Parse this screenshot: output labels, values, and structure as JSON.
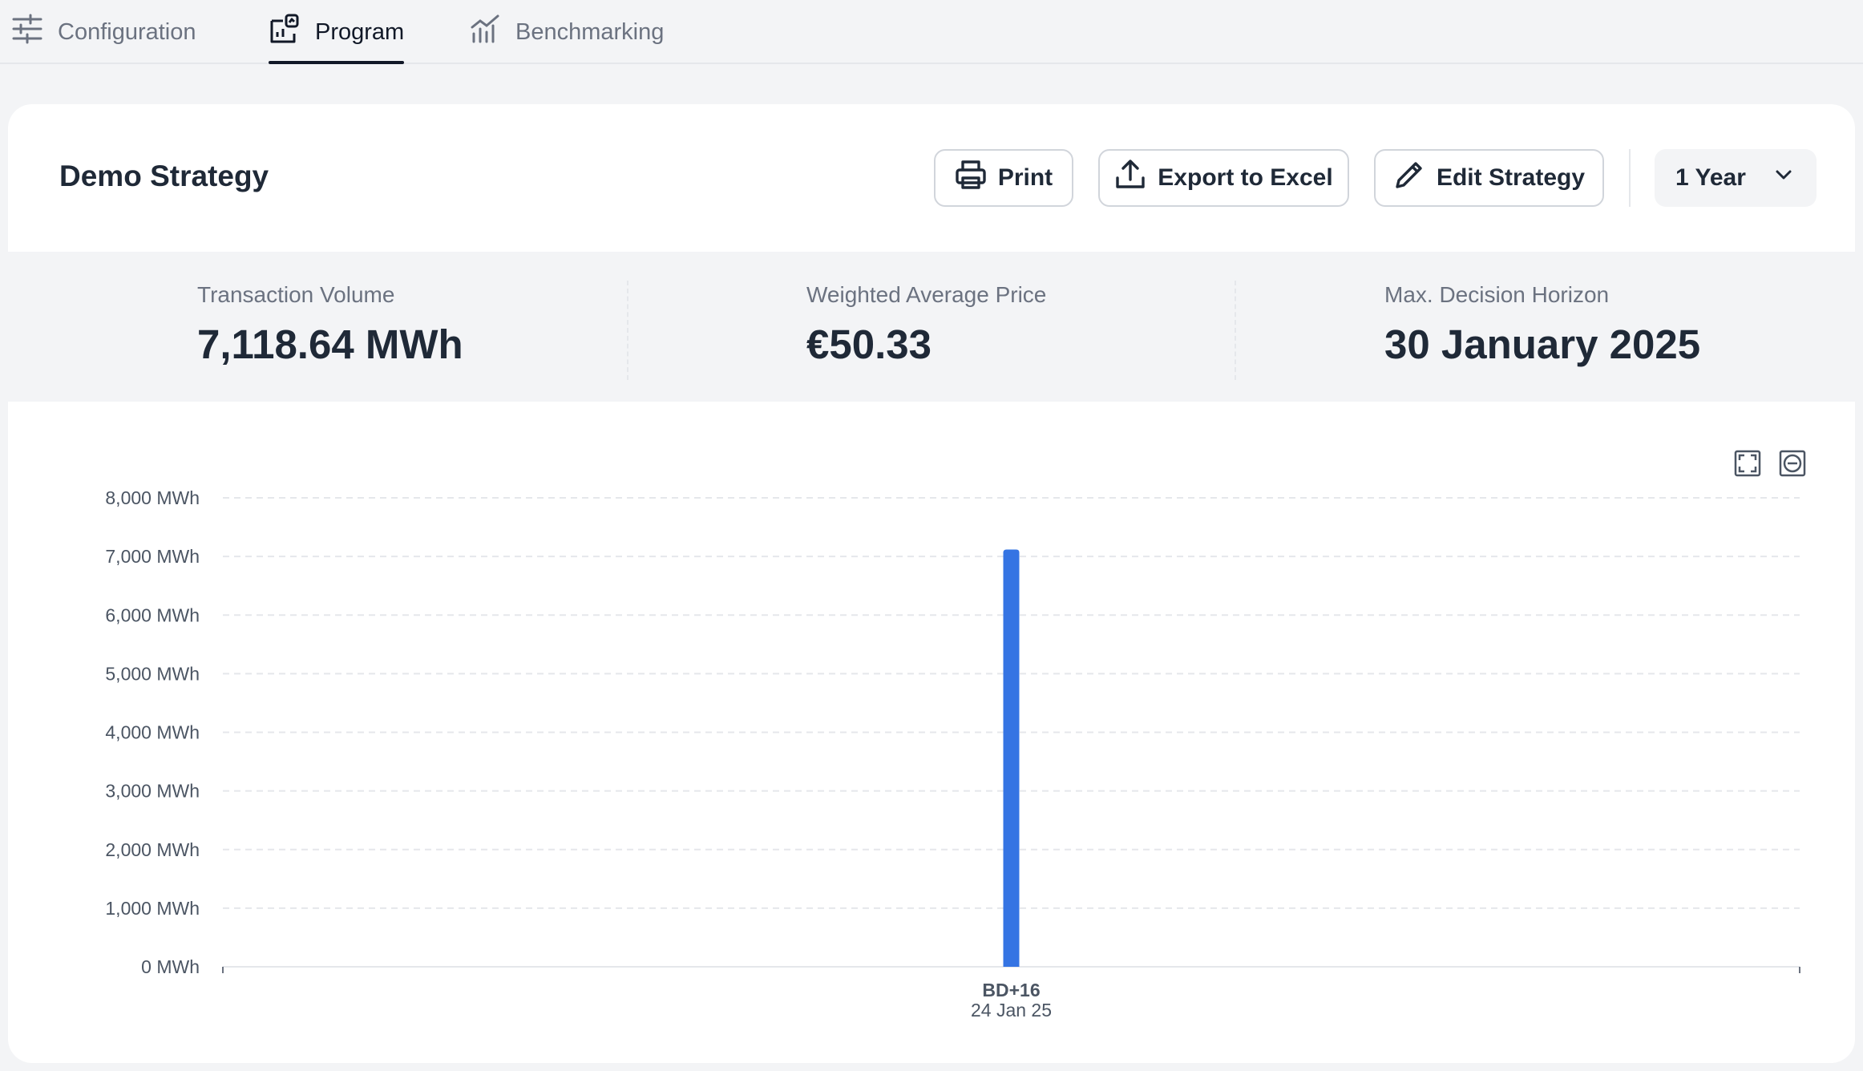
{
  "tabs": [
    {
      "label": "Configuration",
      "icon": "sliders-icon",
      "active": false
    },
    {
      "label": "Program",
      "icon": "program-icon",
      "active": true
    },
    {
      "label": "Benchmarking",
      "icon": "chart-icon",
      "active": false
    }
  ],
  "header": {
    "title": "Demo Strategy",
    "print_label": "Print",
    "export_label": "Export to Excel",
    "edit_label": "Edit Strategy",
    "period_selected": "1 Year"
  },
  "stats": [
    {
      "label": "Transaction Volume",
      "value": "7,118.64 MWh"
    },
    {
      "label": "Weighted Average Price",
      "value": "€50.33"
    },
    {
      "label": "Max. Decision Horizon",
      "value": "30 January 2025"
    }
  ],
  "colors": {
    "accent": "#3574e3",
    "text": "#1f2937",
    "muted": "#6b7280"
  },
  "chart_data": {
    "type": "bar",
    "categories": [
      "BD+16"
    ],
    "category_sublabels": [
      "24 Jan 25"
    ],
    "values": [
      7118.64
    ],
    "ylim": [
      0,
      8000
    ],
    "yticks": [
      0,
      1000,
      2000,
      3000,
      4000,
      5000,
      6000,
      7000,
      8000
    ],
    "ytick_labels": [
      "0 MWh",
      "1,000 MWh",
      "2,000 MWh",
      "3,000 MWh",
      "4,000 MWh",
      "5,000 MWh",
      "6,000 MWh",
      "7,000 MWh",
      "8,000 MWh"
    ],
    "x_position_fraction": 0.5,
    "grid": true
  }
}
